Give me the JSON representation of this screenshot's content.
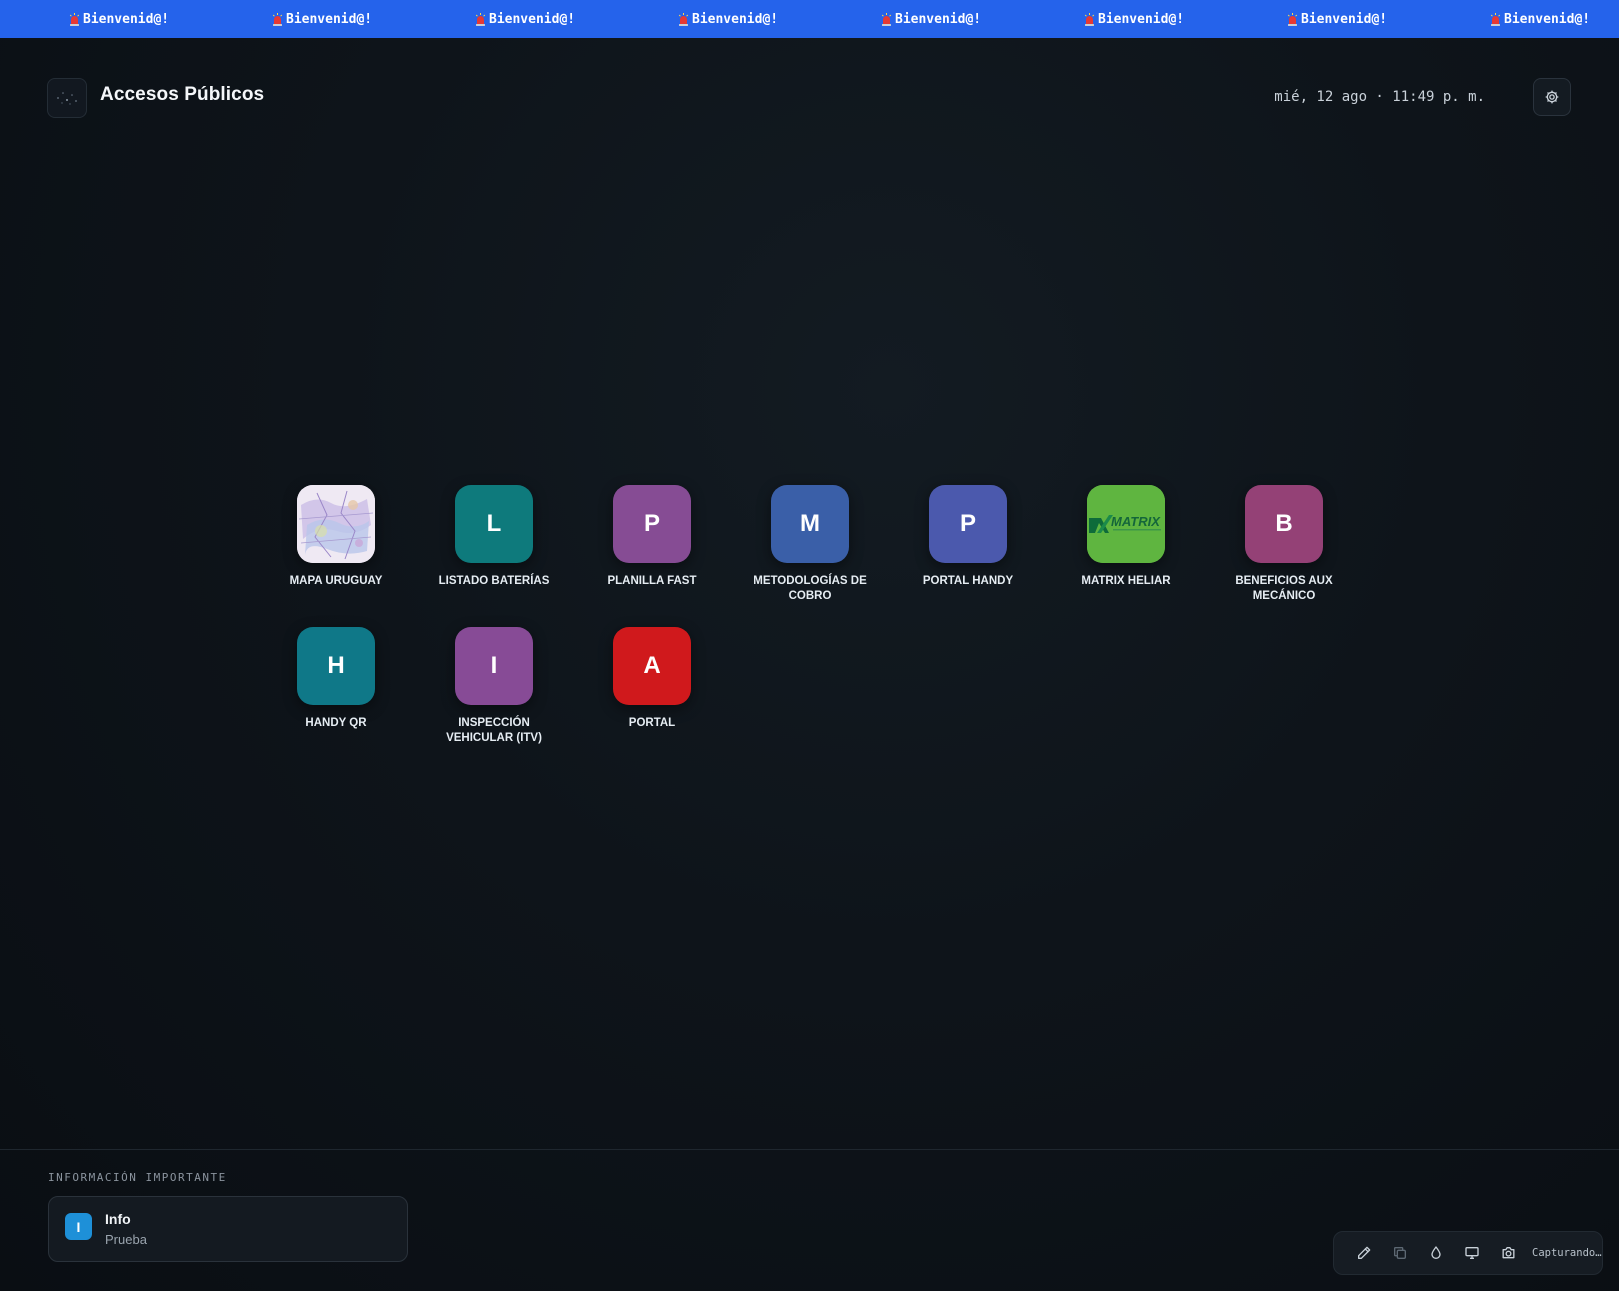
{
  "banner": {
    "message": "Bienvenid@!",
    "icon": "siren-icon",
    "color": "#2563eb",
    "repeat_count": 8
  },
  "header": {
    "title": "Accesos Públicos",
    "datetime": "mié, 12 ago · 11:49 p. m.",
    "settings_icon": "gear-icon"
  },
  "apps": [
    {
      "label": "MAPA URUGUAY",
      "letter": "",
      "color": "#e9e4f0",
      "image": "map-thumbnail"
    },
    {
      "label": "LISTADO BATERÍAS",
      "letter": "L",
      "color": "#0e7a7c"
    },
    {
      "label": "PLANILLA FAST",
      "letter": "P",
      "color": "#864c94"
    },
    {
      "label": "METODOLOGÍAS DE COBRO",
      "letter": "M",
      "color": "#3a5fa8"
    },
    {
      "label": "PORTAL HANDY",
      "letter": "P",
      "color": "#4b59ad"
    },
    {
      "label": "MATRIX HELIAR",
      "letter": "",
      "color": "#5fb540",
      "image": "matrix-logo",
      "logo_text": "MATRIX"
    },
    {
      "label": "BENEFICIOS AUX MECÁNICO",
      "letter": "B",
      "color": "#944176"
    },
    {
      "label": "HANDY QR",
      "letter": "H",
      "color": "#0f7888"
    },
    {
      "label": "INSPECCIÓN VEHICULAR (ITV)",
      "letter": "I",
      "color": "#874b96"
    },
    {
      "label": "PORTAL",
      "letter": "A",
      "color": "#d0191c"
    }
  ],
  "footer": {
    "heading": "INFORMACIÓN IMPORTANTE",
    "card": {
      "badge": "I",
      "title": "Info",
      "body": "Prueba"
    }
  },
  "toolbar": {
    "tools": [
      "pencil-icon",
      "copy-icon",
      "droplet-icon",
      "monitor-icon",
      "camera-icon"
    ],
    "status": "Capturando…"
  }
}
